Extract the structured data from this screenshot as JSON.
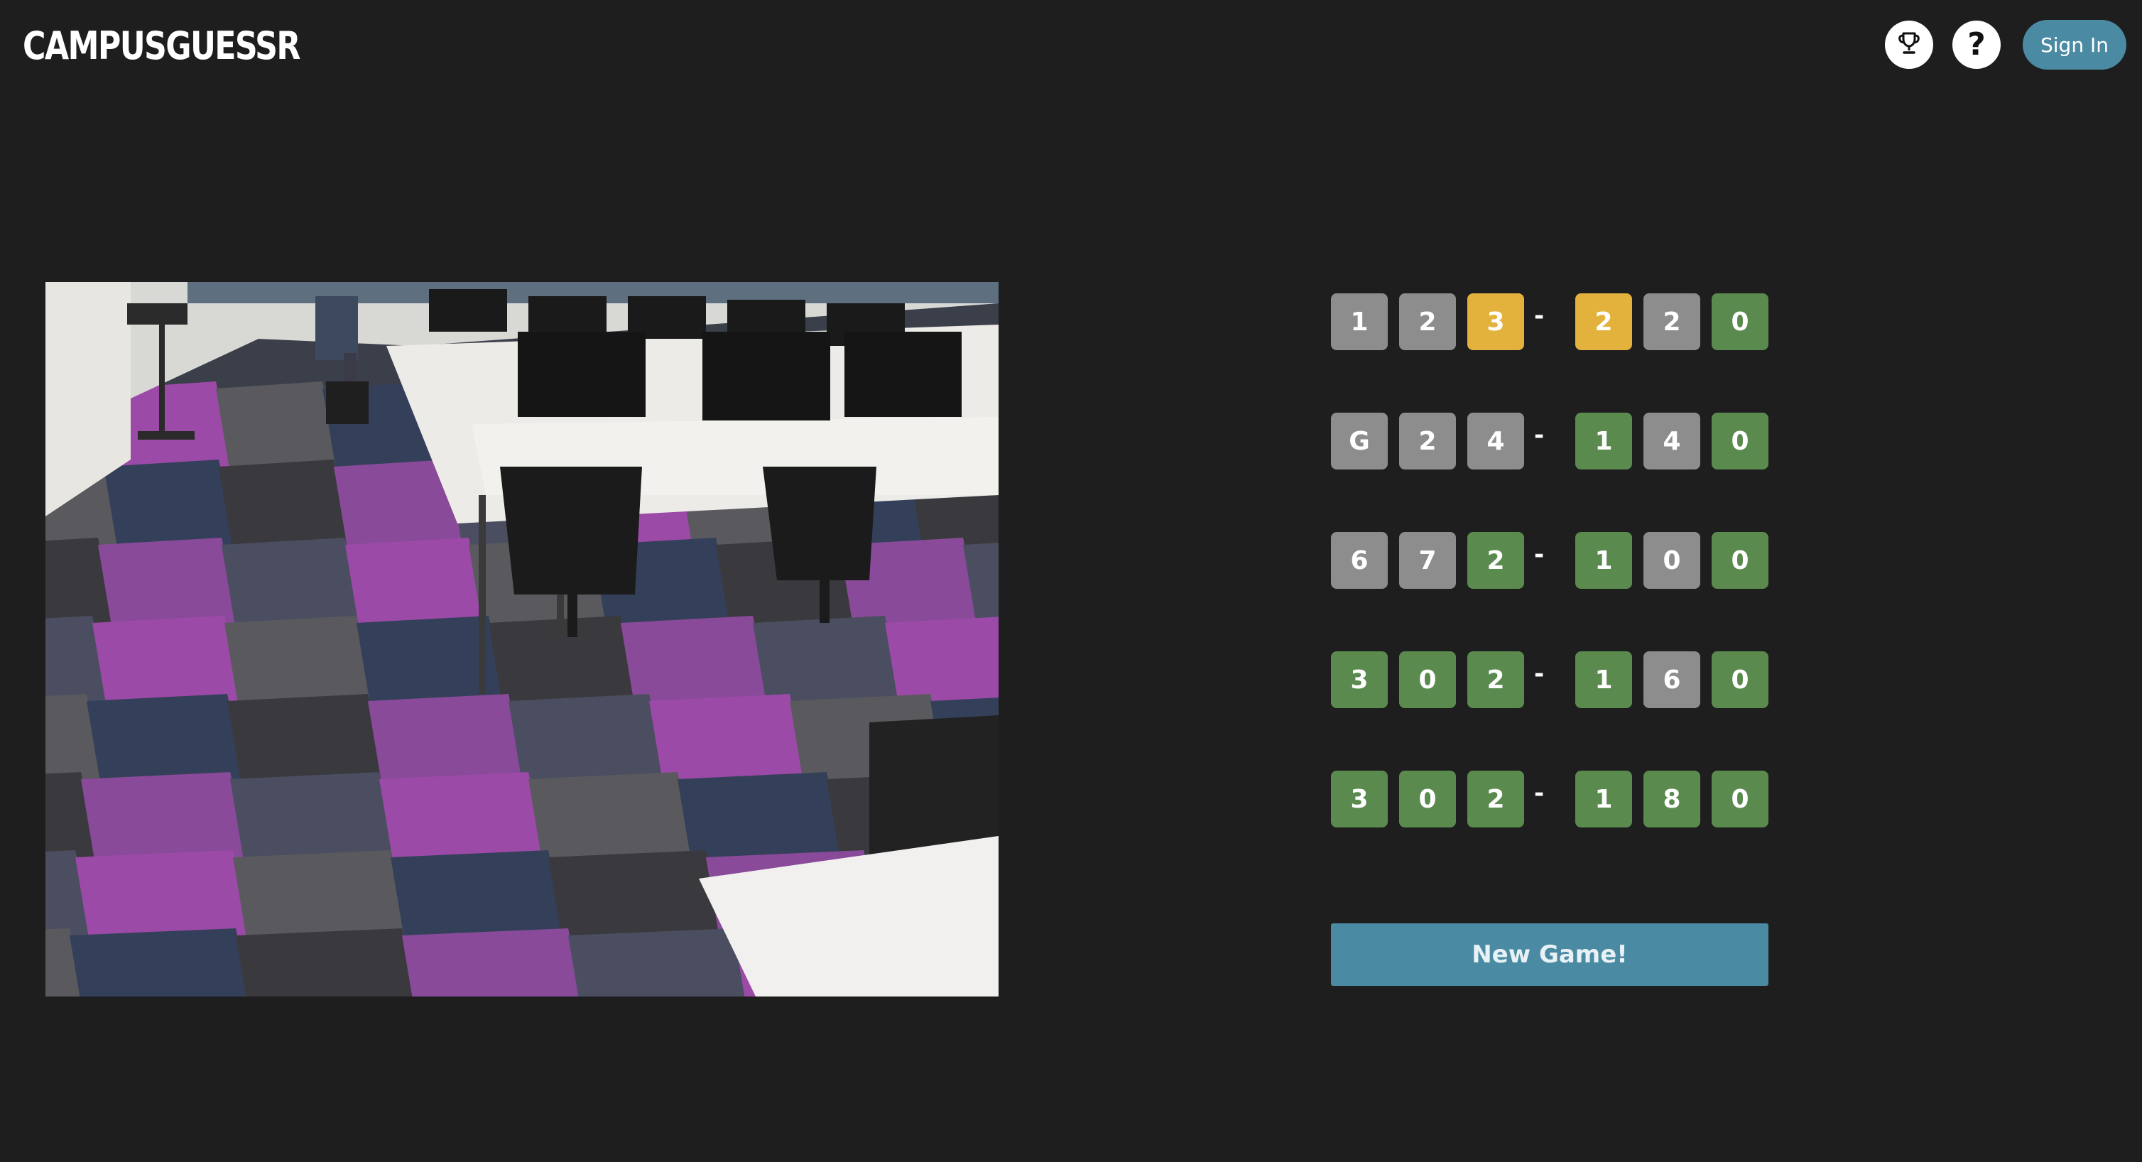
{
  "header": {
    "logo": "CAMPUSGUESSR",
    "trophy_icon": "trophy-icon",
    "help_label": "?",
    "help_icon": "question-mark-icon",
    "signin_label": "Sign In"
  },
  "colors": {
    "background": "#1e1e1e",
    "accent": "#4a8aa3",
    "tile_gray": "#8d8d8d",
    "tile_green": "#5a8a4e",
    "tile_yellow": "#e3b23c"
  },
  "guesses": [
    {
      "left": [
        {
          "char": "1",
          "state": "gray"
        },
        {
          "char": "2",
          "state": "gray"
        },
        {
          "char": "3",
          "state": "yellow"
        }
      ],
      "separator": "-",
      "right": [
        {
          "char": "2",
          "state": "yellow"
        },
        {
          "char": "2",
          "state": "gray"
        },
        {
          "char": "0",
          "state": "green"
        }
      ]
    },
    {
      "left": [
        {
          "char": "G",
          "state": "gray"
        },
        {
          "char": "2",
          "state": "gray"
        },
        {
          "char": "4",
          "state": "gray"
        }
      ],
      "separator": "-",
      "right": [
        {
          "char": "1",
          "state": "green"
        },
        {
          "char": "4",
          "state": "gray"
        },
        {
          "char": "0",
          "state": "green"
        }
      ]
    },
    {
      "left": [
        {
          "char": "6",
          "state": "gray"
        },
        {
          "char": "7",
          "state": "gray"
        },
        {
          "char": "2",
          "state": "green"
        }
      ],
      "separator": "-",
      "right": [
        {
          "char": "1",
          "state": "green"
        },
        {
          "char": "0",
          "state": "gray"
        },
        {
          "char": "0",
          "state": "green"
        }
      ]
    },
    {
      "left": [
        {
          "char": "3",
          "state": "green"
        },
        {
          "char": "0",
          "state": "green"
        },
        {
          "char": "2",
          "state": "green"
        }
      ],
      "separator": "-",
      "right": [
        {
          "char": "1",
          "state": "green"
        },
        {
          "char": "6",
          "state": "gray"
        },
        {
          "char": "0",
          "state": "green"
        }
      ]
    },
    {
      "left": [
        {
          "char": "3",
          "state": "green"
        },
        {
          "char": "0",
          "state": "green"
        },
        {
          "char": "2",
          "state": "green"
        }
      ],
      "separator": "-",
      "right": [
        {
          "char": "1",
          "state": "green"
        },
        {
          "char": "8",
          "state": "green"
        },
        {
          "char": "0",
          "state": "green"
        }
      ]
    }
  ],
  "new_game_label": "New Game!"
}
